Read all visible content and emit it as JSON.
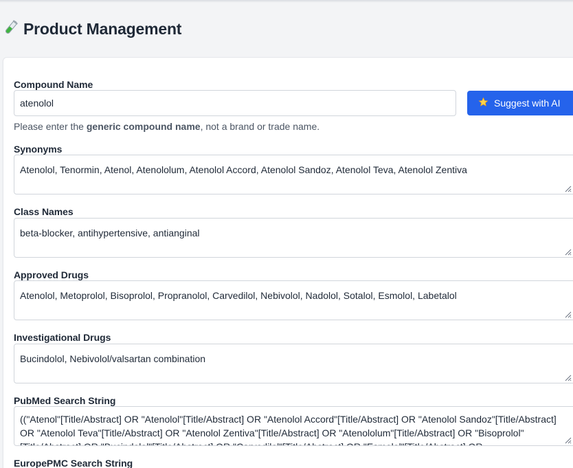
{
  "header": {
    "title": "Product Management",
    "icon": "test-tube-icon"
  },
  "compound": {
    "label": "Compound Name",
    "value": "atenolol",
    "suggest_button": "Suggest with AI",
    "help_prefix": "Please enter the ",
    "help_bold": "generic compound name",
    "help_suffix": ", not a brand or trade name."
  },
  "synonyms": {
    "label": "Synonyms",
    "value": "Atenolol, Tenormin, Atenol, Atenololum, Atenolol Accord, Atenolol Sandoz, Atenolol Teva, Atenolol Zentiva"
  },
  "class_names": {
    "label": "Class Names",
    "value": "beta-blocker, antihypertensive, antianginal"
  },
  "approved_drugs": {
    "label": "Approved Drugs",
    "value": "Atenolol, Metoprolol, Bisoprolol, Propranolol, Carvedilol, Nebivolol, Nadolol, Sotalol, Esmolol, Labetalol"
  },
  "investigational_drugs": {
    "label": "Investigational Drugs",
    "value": "Bucindolol, Nebivolol/valsartan combination"
  },
  "pubmed": {
    "label": "PubMed Search String",
    "value": "((\"Atenol\"[Title/Abstract] OR \"Atenolol\"[Title/Abstract] OR \"Atenolol Accord\"[Title/Abstract] OR \"Atenolol Sandoz\"[Title/Abstract] OR \"Atenolol Teva\"[Title/Abstract] OR \"Atenolol Zentiva\"[Title/Abstract] OR \"Atenololum\"[Title/Abstract] OR \"Bisoprolol\"[Title/Abstract] OR \"Bucindolol\"[Title/Abstract] OR \"Carvedilol\"[Title/Abstract] OR \"Esmolol\"[Title/Abstract] OR"
  },
  "europepmc": {
    "label": "EuropePMC Search String"
  },
  "colors": {
    "accent": "#2563eb",
    "background": "#f3f4f6",
    "border": "#d1d5db"
  }
}
